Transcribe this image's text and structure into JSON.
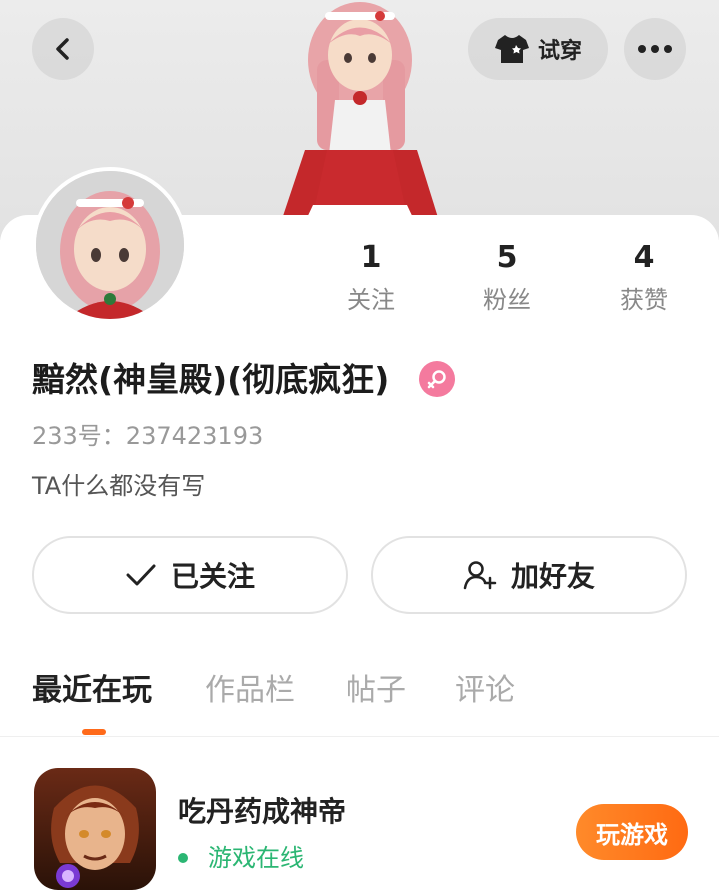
{
  "header": {
    "back_icon": "chevron-left-icon",
    "tryon_label": "试穿",
    "tryon_icon": "shirt-icon",
    "more_icon": "more-horizontal-icon"
  },
  "profile": {
    "nickname": "黯然(神皇殿)(彻底疯狂)",
    "gender_icon": "female-icon",
    "uid": "233号：237423193",
    "bio": "TA什么都没有写"
  },
  "stats": [
    {
      "value": "1",
      "label": "关注"
    },
    {
      "value": "5",
      "label": "粉丝"
    },
    {
      "value": "4",
      "label": "获赞"
    }
  ],
  "actions": {
    "followed_label": "已关注",
    "add_friend_label": "加好友"
  },
  "tabs": [
    {
      "label": "最近在玩",
      "active": true
    },
    {
      "label": "作品栏",
      "active": false
    },
    {
      "label": "帖子",
      "active": false
    },
    {
      "label": "评论",
      "active": false
    }
  ],
  "recent_game": {
    "title": "吃丹药成神帝",
    "status": "游戏在线",
    "play_label": "玩游戏"
  },
  "colors": {
    "accent": "#ff6a1a",
    "online": "#2bb673",
    "female": "#f47a9e"
  }
}
